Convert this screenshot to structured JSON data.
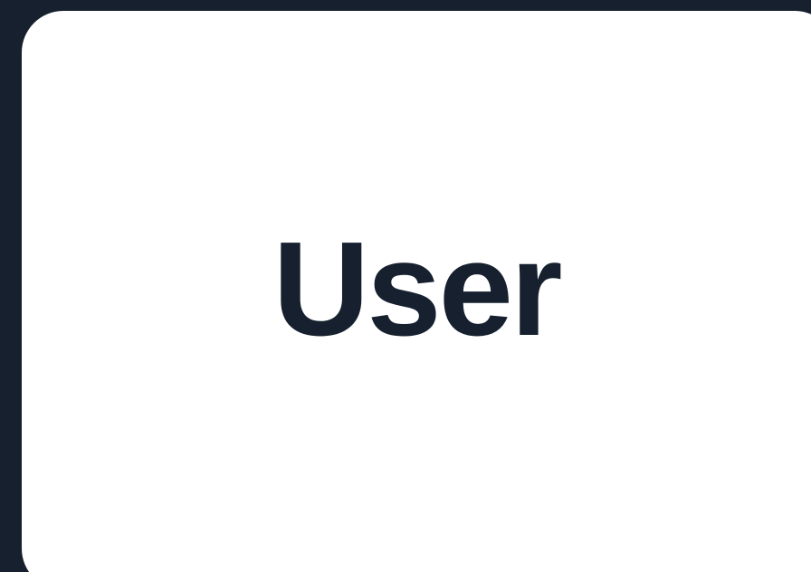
{
  "card": {
    "label": "User"
  },
  "colors": {
    "background": "#16202f",
    "card": "#ffffff",
    "text": "#16202f"
  }
}
